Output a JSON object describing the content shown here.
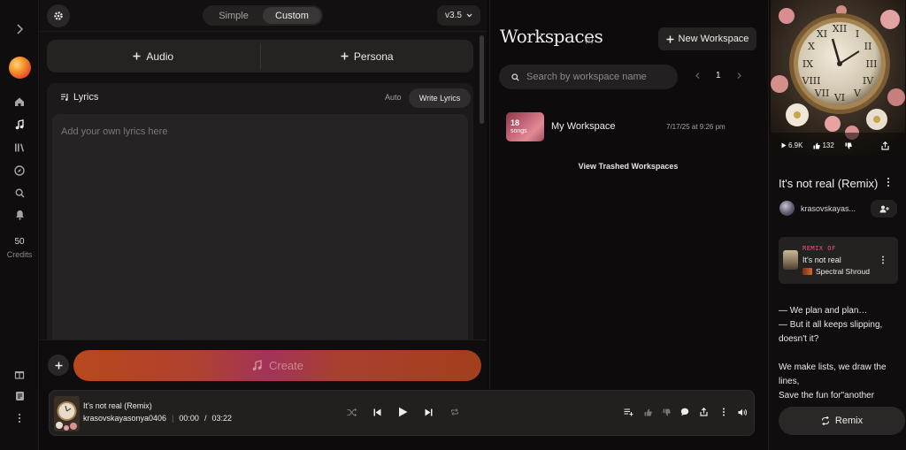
{
  "sidebar": {
    "credits_count": "50",
    "credits_label": "Credits",
    "icons": [
      "chevron-right-icon",
      "home-icon",
      "music-icon",
      "library-icon",
      "explore-icon",
      "search-icon",
      "bell-icon",
      "gift-icon",
      "notes-icon",
      "more-icon"
    ]
  },
  "create": {
    "mode_tabs": [
      "Simple",
      "Custom"
    ],
    "active_mode": "Custom",
    "version": "v3.5",
    "add_audio": "Audio",
    "add_persona": "Persona",
    "lyrics_label": "Lyrics",
    "auto_label": "Auto",
    "write_lyrics_label": "Write Lyrics",
    "lyrics_placeholder": "Add your own lyrics here",
    "create_label": "Create"
  },
  "workspaces": {
    "title": "Workspaces",
    "count": "(1)",
    "new_button": "New Workspace",
    "search_placeholder": "Search by workspace name",
    "page": "1",
    "items": [
      {
        "songs_count": "18",
        "songs_label": "songs",
        "name": "My Workspace",
        "date": "7/17/25 at 9:26 pm"
      }
    ],
    "trashed_link": "View Trashed Workspaces"
  },
  "song_panel": {
    "plays": "6.9K",
    "likes": "132",
    "title": "It's not real (Remix)",
    "artist": "krasovskayas...",
    "remix_of_label": "REMIX OF",
    "remix_of_title": "It's not real",
    "remix_of_artist": "Spectral Shroud",
    "lyrics": "— We plan and plan…\n— But it all keeps slipping, doesn't it?\n\nWe make lists, we draw the lines,\nSave the fun for\"another",
    "remix_button": "Remix"
  },
  "player": {
    "title": "It's not real (Remix)",
    "artist": "krasovskayasonya0406",
    "current_time": "00:00",
    "separator": "/",
    "duration": "03:22"
  },
  "colors": {
    "accent_create_start": "#b8481c",
    "accent_create_mid": "#a2335a",
    "remix_label": "#e45a8b"
  }
}
